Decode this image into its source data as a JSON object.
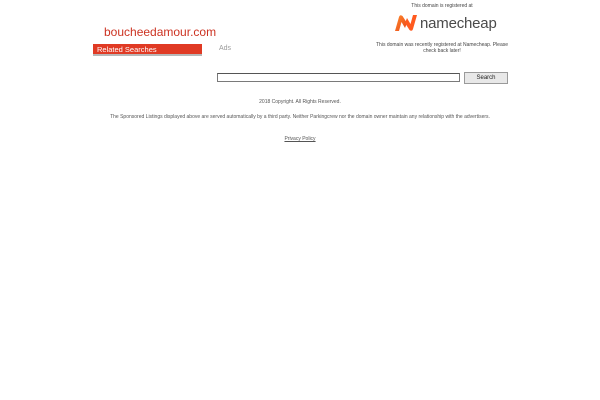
{
  "header": {
    "domain_title": "boucheedamour.com",
    "related_searches_label": "Related Searches",
    "ads_label": "Ads"
  },
  "registrar": {
    "registered_at_text": "This domain is registered at",
    "logo_name": "namecheap",
    "logo_icon": "namecheap-n-logo-icon",
    "message": "This domain was recently registered at Namecheap. Please check back later!",
    "brand_color": "#ff5a1f"
  },
  "search": {
    "input_value": "",
    "button_label": "Search"
  },
  "footer": {
    "copyright": "2018 Copyright.  All Rights Reserved.",
    "disclaimer": "The Sponsored Listings displayed above are served automatically by a third party. Neither Parkingcrew nor the domain owner maintain any relationship with the advertisers.",
    "privacy_policy_label": "Privacy Policy"
  },
  "colors": {
    "accent_red": "#e03a24",
    "title_red": "#cc3322"
  }
}
